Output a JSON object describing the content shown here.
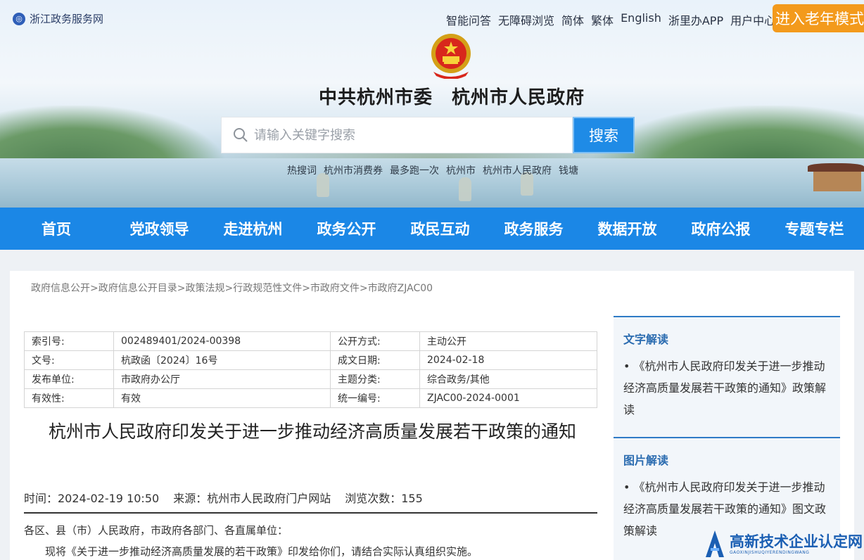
{
  "header": {
    "site_link": "浙江政务服务网",
    "top_links": [
      "智能问答",
      "无障碍浏览",
      "简体",
      "繁体",
      "English",
      "浙里办APP",
      "用户中心"
    ],
    "elder_mode": "进入老年模式",
    "site_title": "中共杭州市委　杭州市人民政府",
    "search": {
      "placeholder": "请输入关键字搜索",
      "button": "搜索"
    },
    "hot": [
      "热搜词",
      "杭州市消费券",
      "最多跑一次",
      "杭州市",
      "杭州市人民政府",
      "钱塘"
    ]
  },
  "nav": [
    "首页",
    "党政领导",
    "走进杭州",
    "政务公开",
    "政民互动",
    "政务服务",
    "数据开放",
    "政府公报",
    "专题专栏"
  ],
  "breadcrumb": [
    "政府信息公开",
    "政府信息公开目录",
    "政策法规",
    "行政规范性文件",
    "市政府文件",
    "市政府ZJAC00"
  ],
  "meta": [
    [
      "索引号:",
      "002489401/2024-00398",
      "公开方式:",
      "主动公开"
    ],
    [
      "文号:",
      "杭政函〔2024〕16号",
      "成文日期:",
      "2024-02-18"
    ],
    [
      "发布单位:",
      "市政府办公厅",
      "主题分类:",
      "综合政务/其他"
    ],
    [
      "有效性:",
      "有效",
      "统一编号:",
      "ZJAC00-2024-0001"
    ]
  ],
  "article": {
    "title": "杭州市人民政府印发关于进一步推动经济高质量发展若干政策的通知",
    "time": "时间：2024-02-19 10:50",
    "source": "来源：杭州市人民政府门户网站",
    "views": "浏览次数：155",
    "salutation": "各区、县（市）人民政府，市政府各部门、各直属单位：",
    "body": "现将《关于进一步推动经济高质量发展的若干政策》印发给你们，请结合实际认真组织实施。"
  },
  "sidebar": {
    "text_interp": {
      "heading": "文字解读",
      "item": "• 《杭州市人民政府印发关于进一步推动经济高质量发展若干政策的通知》政策解读"
    },
    "image_interp": {
      "heading": "图片解读",
      "item": "• 《杭州市人民政府印发关于进一步推动经济高质量发展若干政策的通知》图文政策解读"
    }
  },
  "watermark": {
    "text": "高新技术企业认定网",
    "sub": "GAOXINJISHUQIYERENDINGWANG"
  },
  "colors": {
    "nav_blue": "#1b87e6",
    "elder_orange": "#f39a1c",
    "side_heading": "#2b6cb0"
  }
}
